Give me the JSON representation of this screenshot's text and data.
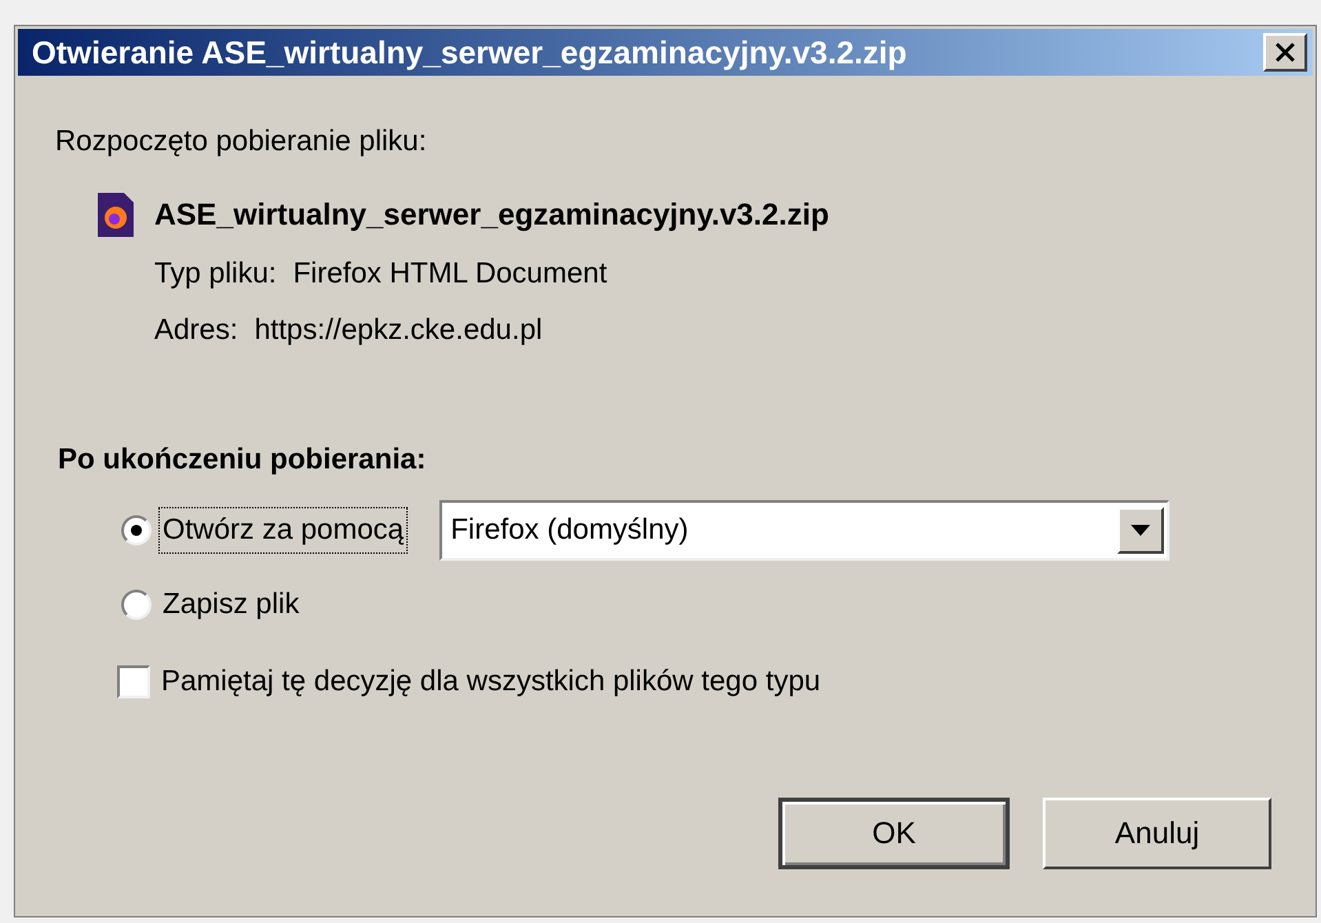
{
  "window": {
    "title": "Otwieranie ASE_wirtualny_serwer_egzaminacyjny.v3.2.zip"
  },
  "intro": "Rozpoczęto pobieranie pliku:",
  "file": {
    "name": "ASE_wirtualny_serwer_egzaminacyjny.v3.2.zip",
    "details": [
      {
        "label": "Typ pliku:",
        "value": "Firefox HTML Document"
      },
      {
        "label": "Adres:",
        "value": "https://epkz.cke.edu.pl"
      }
    ]
  },
  "section_title": "Po ukończeniu pobierania:",
  "options": [
    {
      "label": "Otwórz za pomocą",
      "selected": true,
      "focused": true
    },
    {
      "label": "Zapisz plik",
      "selected": false,
      "focused": false
    }
  ],
  "app_select": {
    "value": "Firefox (domyślny)"
  },
  "remember": {
    "label": "Pamiętaj tę decyzję dla wszystkich plików tego typu",
    "checked": false
  },
  "buttons": [
    {
      "label": "OK",
      "default": true
    },
    {
      "label": "Anuluj",
      "default": false
    }
  ]
}
